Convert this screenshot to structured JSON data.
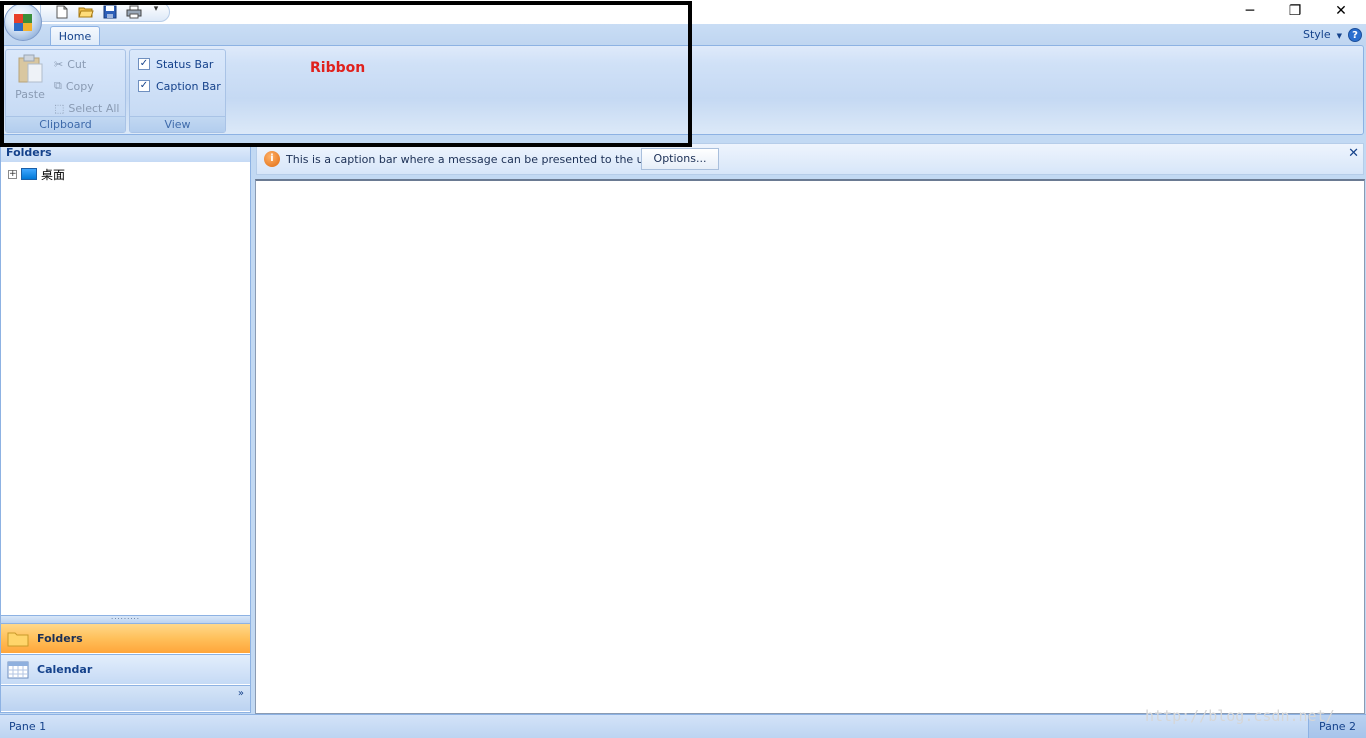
{
  "qat": {
    "icons": [
      "new-file-icon",
      "open-folder-icon",
      "save-icon",
      "print-icon"
    ],
    "customize_arrow": "▾"
  },
  "window_controls": {
    "minimize": "─",
    "restore": "❐",
    "close": "✕"
  },
  "tabs": [
    {
      "label": "Home",
      "active": true
    }
  ],
  "style_menu": {
    "label": "Style"
  },
  "help": {
    "label": "?"
  },
  "ribbon": {
    "annotation": "Ribbon",
    "clipboard": {
      "label": "Clipboard",
      "paste": "Paste",
      "cut": "Cut",
      "copy": "Copy",
      "select_all": "Select All"
    },
    "view": {
      "label": "View",
      "status_bar": {
        "label": "Status Bar",
        "checked": true
      },
      "caption_bar": {
        "label": "Caption Bar",
        "checked": true
      }
    }
  },
  "left_pane": {
    "header": "Folders",
    "tree": [
      {
        "label": "桌面",
        "expander": "+"
      }
    ],
    "splitter_grip": "·········",
    "nav": [
      {
        "label": "Folders",
        "active": true
      },
      {
        "label": "Calendar",
        "active": false
      }
    ],
    "more": "»"
  },
  "caption_bar": {
    "icon": "i",
    "message": "This is a caption bar where a message can be presented to the user.",
    "options": "Options...",
    "close": "✕"
  },
  "status_bar": {
    "pane1": "Pane 1",
    "pane2": "Pane 2"
  },
  "watermark": "http://blog.csdn.net/",
  "colors": {
    "accent": "#15428b",
    "annotation": "#e0211d",
    "active_nav": "#ffc05a",
    "ribbon_bg": "#d0e1f7"
  }
}
